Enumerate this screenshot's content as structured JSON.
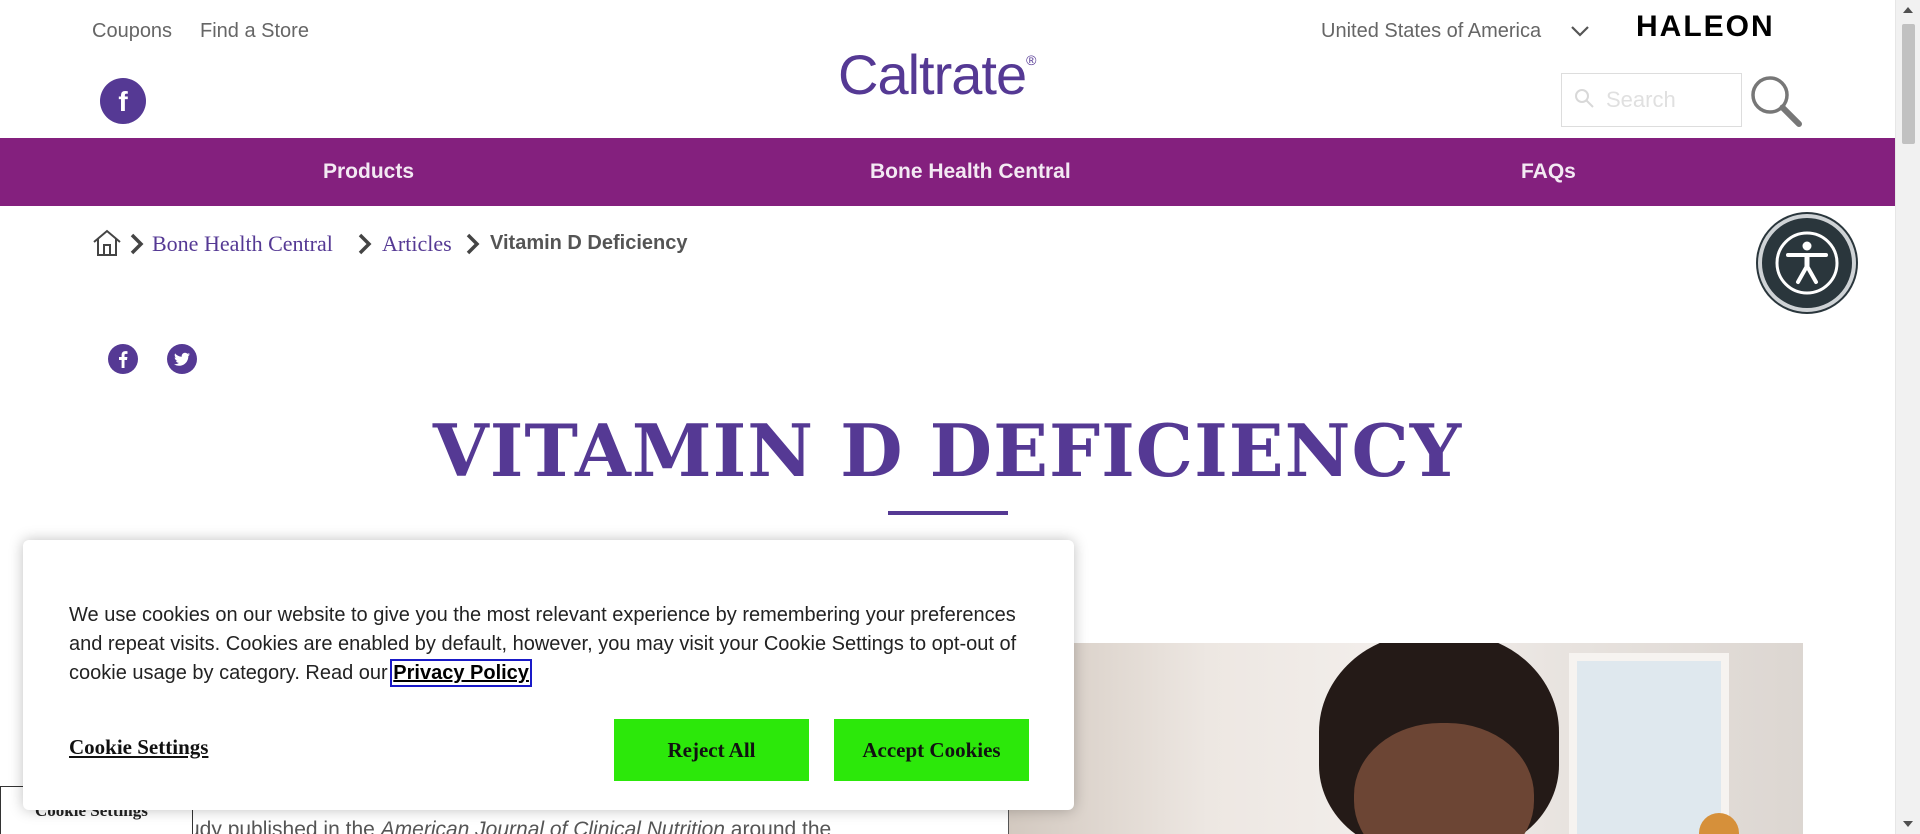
{
  "header": {
    "links": [
      "Coupons",
      "Find a Store"
    ],
    "country": "United States of America",
    "corporate_logo": "HALEON",
    "brand_logo": "Caltrate",
    "brand_mark": "®",
    "facebook_glyph": "f",
    "search_placeholder": "Search"
  },
  "nav": {
    "items": [
      "Products",
      "Bone Health Central",
      "FAQs"
    ],
    "color": "#84207e"
  },
  "breadcrumb": {
    "home_icon": "home-icon",
    "items": [
      "Bone Health Central",
      "Articles"
    ],
    "current": "Vitamin D Deficiency"
  },
  "share": {
    "icons": [
      "facebook-icon",
      "twitter-icon"
    ]
  },
  "article": {
    "title": "VITAMIN D DEFICIENCY",
    "intro_prefix": "udy published in the ",
    "intro_italic": "American Journal of Clinical Nutrition",
    "intro_suffix": " around the"
  },
  "cookie_banner": {
    "text": "We use cookies on our website to give you the most relevant experience by remembering your preferences and repeat visits. Cookies are enabled by default, however, you may visit your Cookie Settings to opt-out of cookie usage by category. Read our ",
    "privacy_link": "Privacy Policy",
    "settings_label": "Cookie Settings",
    "reject_label": "Reject All",
    "accept_label": "Accept Cookies",
    "button_color": "#2ce80a"
  },
  "cookie_tab": {
    "label": "Cookie Settings"
  },
  "theme": {
    "purple": "#553994"
  }
}
